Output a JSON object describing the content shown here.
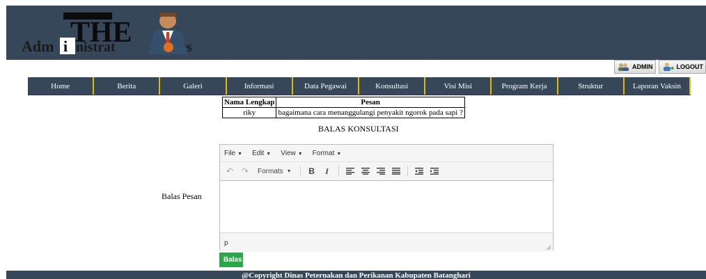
{
  "header": {
    "logo_text": "AdministrATors"
  },
  "userbar": {
    "admin_label": "ADMIN",
    "logout_label": "LOGOUT"
  },
  "nav": {
    "items": [
      {
        "label": "Home"
      },
      {
        "label": "Berita"
      },
      {
        "label": "Galeri"
      },
      {
        "label": "Informasi"
      },
      {
        "label": "Data Pegawai"
      },
      {
        "label": "Konsultasi"
      },
      {
        "label": "Visi Misi"
      },
      {
        "label": "Program Kerja"
      },
      {
        "label": "Struktur"
      },
      {
        "label": "Laporan Vaksin"
      }
    ],
    "accent_color": "#e6b800",
    "bar_color": "#36475a"
  },
  "message": {
    "headers": [
      "Nama Lengkap",
      "Pesan"
    ],
    "row": {
      "nama": "riky",
      "pesan": "bagaimana cara menanggulangi penyakit ngorok pada sapi ?"
    }
  },
  "form": {
    "title": "BALAS KONSULTASI",
    "label": "Balas Pesan",
    "submit_label": "Balas",
    "submit_color": "#2aa747"
  },
  "editor": {
    "menus": [
      "File",
      "Edit",
      "View",
      "Format"
    ],
    "formats_label": "Formats",
    "bold_label": "B",
    "italic_label": "I",
    "status_path": "p"
  },
  "footer": {
    "text": "@Copyright Dinas Peternakan dan Perikanan Kabupaten Batanghari"
  }
}
